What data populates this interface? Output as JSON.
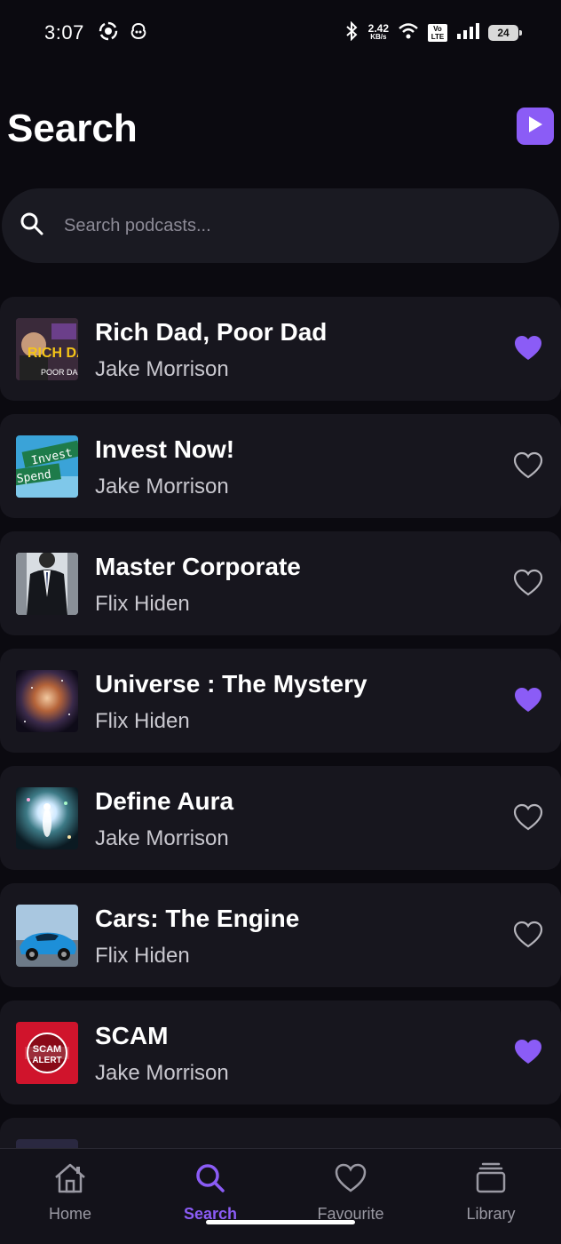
{
  "status_bar": {
    "time": "3:07",
    "net_speed": "2.42",
    "net_unit": "KB/s",
    "volte": "Vo LTE",
    "battery": "24"
  },
  "header": {
    "title": "Search"
  },
  "search": {
    "placeholder": "Search podcasts..."
  },
  "podcasts": [
    {
      "title": "Rich Dad, Poor Dad",
      "author": "Jake Morrison",
      "favourite": true,
      "thumb_text": "RICH DAD",
      "thumb_sub": "POOR DAD"
    },
    {
      "title": "Invest Now!",
      "author": "Jake Morrison",
      "favourite": false,
      "thumb_text": "Invest",
      "thumb_sub": "Spend"
    },
    {
      "title": "Master Corporate",
      "author": "Flix Hiden",
      "favourite": false
    },
    {
      "title": "Universe : The Mystery",
      "author": "Flix Hiden",
      "favourite": true
    },
    {
      "title": "Define Aura",
      "author": "Jake Morrison",
      "favourite": false
    },
    {
      "title": "Cars: The Engine",
      "author": "Flix Hiden",
      "favourite": false
    },
    {
      "title": "SCAM",
      "author": "Jake Morrison",
      "favourite": true,
      "thumb_text": "SCAM",
      "thumb_sub": "ALERT"
    }
  ],
  "bottom_nav": [
    {
      "label": "Home",
      "icon": "home-icon",
      "active": false
    },
    {
      "label": "Search",
      "icon": "search-icon",
      "active": true
    },
    {
      "label": "Favourite",
      "icon": "heart-icon",
      "active": false
    },
    {
      "label": "Library",
      "icon": "library-icon",
      "active": false
    }
  ],
  "colors": {
    "accent": "#8b5cf6",
    "background": "#0b0a10",
    "card": "#17161e"
  }
}
